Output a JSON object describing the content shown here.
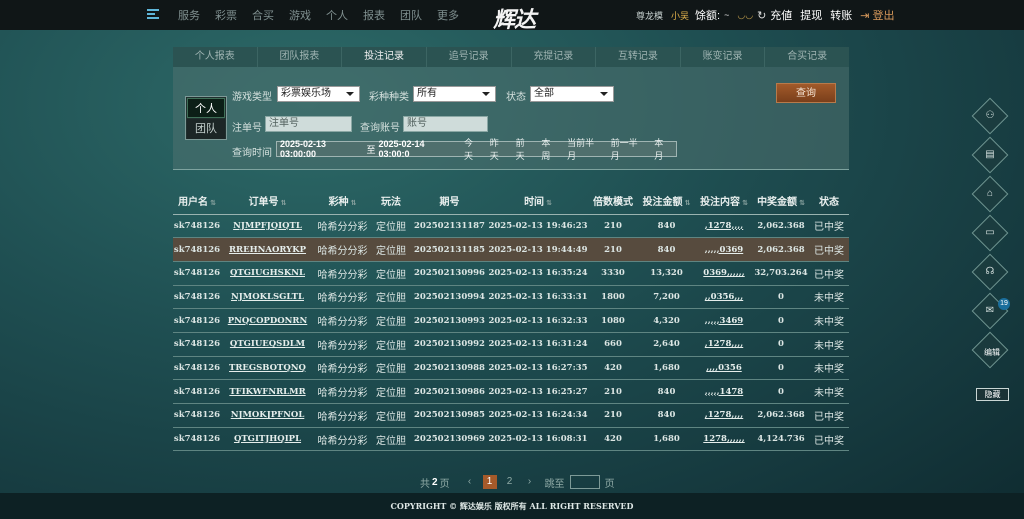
{
  "topbar": {
    "nav": [
      "服务",
      "彩票",
      "合买",
      "游戏",
      "个人",
      "报表",
      "团队",
      "更多"
    ],
    "logo": "辉达",
    "user_name": "尊龙模",
    "user_tag": "小吴",
    "balance_label": "馀额:",
    "balance_value": "~",
    "deposit": "充値",
    "withdraw": "提现",
    "transfer": "转账",
    "logout": "登出"
  },
  "tabs": [
    "个人报表",
    "团队报表",
    "投注记录",
    "追号记录",
    "充提记录",
    "互转记录",
    "账变记录",
    "合买记录"
  ],
  "active_tab": 2,
  "filter": {
    "seg_personal": "个人",
    "seg_team": "团队",
    "game_type_label": "游戏类型",
    "game_type_value": "彩票娱乐场",
    "lottery_label": "彩种种类",
    "lottery_value": "所有",
    "status_label": "状态",
    "status_value": "全部",
    "order_label": "注单号",
    "order_placeholder": "注单号",
    "account_label": "查询账号",
    "account_placeholder": "账号",
    "time_label": "查询时间",
    "date_from": "2025-02-13 03:00:00",
    "date_to_sep": "至",
    "date_to": "2025-02-14 03:00:0",
    "quick": [
      "今天",
      "昨天",
      "前天",
      "本周",
      "当前半月",
      "前一半月",
      "本月"
    ],
    "query_button": "查询"
  },
  "table": {
    "headers": [
      "用户名",
      "订单号",
      "彩种",
      "玩法",
      "期号",
      "时间",
      "倍数模式",
      "投注金额",
      "投注内容",
      "中奖金额",
      "状态"
    ],
    "rows": [
      [
        "sk748126",
        "NJMPFJQIQTL",
        "哈希分分彩",
        "定位胆",
        "202502131187",
        "2025-02-13 19:46:23",
        "210",
        "840",
        ",1278,,,,",
        "2,062.368",
        "已中奖"
      ],
      [
        "sk748126",
        "RREHNAORYKP",
        "哈希分分彩",
        "定位胆",
        "202502131185",
        "2025-02-13 19:44:49",
        "210",
        "840",
        ",,,,,0369",
        "2,062.368",
        "已中奖"
      ],
      [
        "sk748126",
        "QTGIUGHSKNL",
        "哈希分分彩",
        "定位胆",
        "202502130996",
        "2025-02-13 16:35:24",
        "3330",
        "13,320",
        "0369,,,,,,",
        "32,703.264",
        "已中奖"
      ],
      [
        "sk748126",
        "NJMOKLSGLTL",
        "哈希分分彩",
        "定位胆",
        "202502130994",
        "2025-02-13 16:33:31",
        "1800",
        "7,200",
        ",,0356,,,",
        "0",
        "未中奖"
      ],
      [
        "sk748126",
        "PNQCOPDONRN",
        "哈希分分彩",
        "定位胆",
        "202502130993",
        "2025-02-13 16:32:33",
        "1080",
        "4,320",
        ",,,,,3469",
        "0",
        "未中奖"
      ],
      [
        "sk748126",
        "QTGIUEQSDLM",
        "哈希分分彩",
        "定位胆",
        "202502130992",
        "2025-02-13 16:31:24",
        "660",
        "2,640",
        ",1278,,,,",
        "0",
        "未中奖"
      ],
      [
        "sk748126",
        "TREGSBOTQNQ",
        "哈希分分彩",
        "定位胆",
        "202502130988",
        "2025-02-13 16:27:35",
        "420",
        "1,680",
        ",,,,0356",
        "0",
        "未中奖"
      ],
      [
        "sk748126",
        "TFIKWFNRLMR",
        "哈希分分彩",
        "定位胆",
        "202502130986",
        "2025-02-13 16:25:27",
        "210",
        "840",
        ",,,,,1478",
        "0",
        "未中奖"
      ],
      [
        "sk748126",
        "NJMOKJPFNOL",
        "哈希分分彩",
        "定位胆",
        "202502130985",
        "2025-02-13 16:24:34",
        "210",
        "840",
        ",1278,,,,",
        "2,062.368",
        "已中奖"
      ],
      [
        "sk748126",
        "QTGITJHQIPL",
        "哈希分分彩",
        "定位胆",
        "202502130969",
        "2025-02-13 16:08:31",
        "420",
        "1,680",
        "1278,,,,,,",
        "4,124.736",
        "已中奖"
      ]
    ],
    "highlight_row": 1
  },
  "pager": {
    "total_prefix": "共",
    "total_pages": "2",
    "total_suffix": "页",
    "prev": "‹",
    "pages": [
      "1",
      "2"
    ],
    "next": "›",
    "jump_label": "跳至",
    "jump_suffix": "页"
  },
  "side": {
    "badge": "19",
    "edit_label": "编辑",
    "hide_label": "隐藏"
  },
  "footer": "COPYRIGHT © 辉达娱乐 版权所有 ALL RIGHT RESERVED"
}
